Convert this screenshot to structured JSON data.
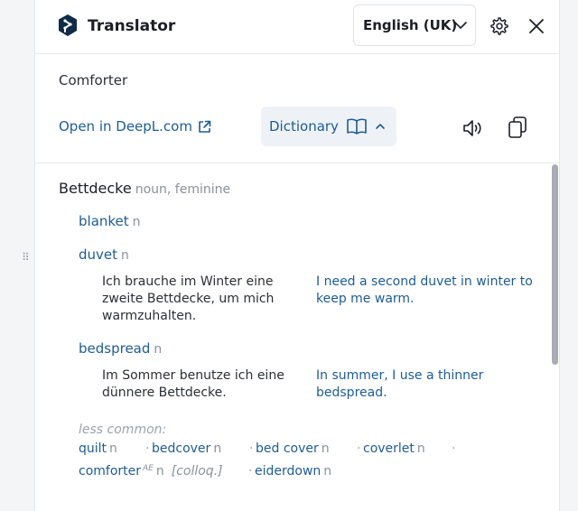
{
  "header": {
    "title": "Translator",
    "language": "English (UK)"
  },
  "source": {
    "word": "Comforter",
    "open_link": "Open in DeepL.com",
    "dictionary_label": "Dictionary"
  },
  "dictionary": {
    "headword": "Bettdecke",
    "headword_pos": "noun, feminine",
    "entries": [
      {
        "word": "blanket",
        "pos": "n"
      },
      {
        "word": "duvet",
        "pos": "n",
        "example_src": "Ich brauche im Winter eine zweite Bettdecke, um mich warmzuhalten.",
        "example_tgt": "I need a second duvet in winter to keep me warm."
      },
      {
        "word": "bedspread",
        "pos": "n",
        "example_src": "Im Sommer benutze ich eine dünnere Bettdecke.",
        "example_tgt": "In summer, I use a thinner bedspread."
      }
    ],
    "less_common_label": "less common:",
    "synonyms": [
      {
        "word": "quilt",
        "pos": "n"
      },
      {
        "word": "bedcover",
        "pos": "n"
      },
      {
        "word": "bed cover",
        "pos": "n"
      },
      {
        "word": "coverlet",
        "pos": "n"
      },
      {
        "word": "comforter",
        "sup": "AE",
        "pos": "n",
        "register": "[colloq.]"
      },
      {
        "word": "eiderdown",
        "pos": "n"
      }
    ]
  },
  "colors": {
    "accent": "#1d5c95",
    "muted": "#8a929c",
    "logo": "#0f2b46"
  },
  "icons": [
    "drag-handle-icon",
    "deepl-logo-icon",
    "chevron-down-icon",
    "gear-icon",
    "close-icon",
    "external-link-icon",
    "book-icon",
    "chevron-up-icon",
    "speaker-icon",
    "copy-icon"
  ]
}
